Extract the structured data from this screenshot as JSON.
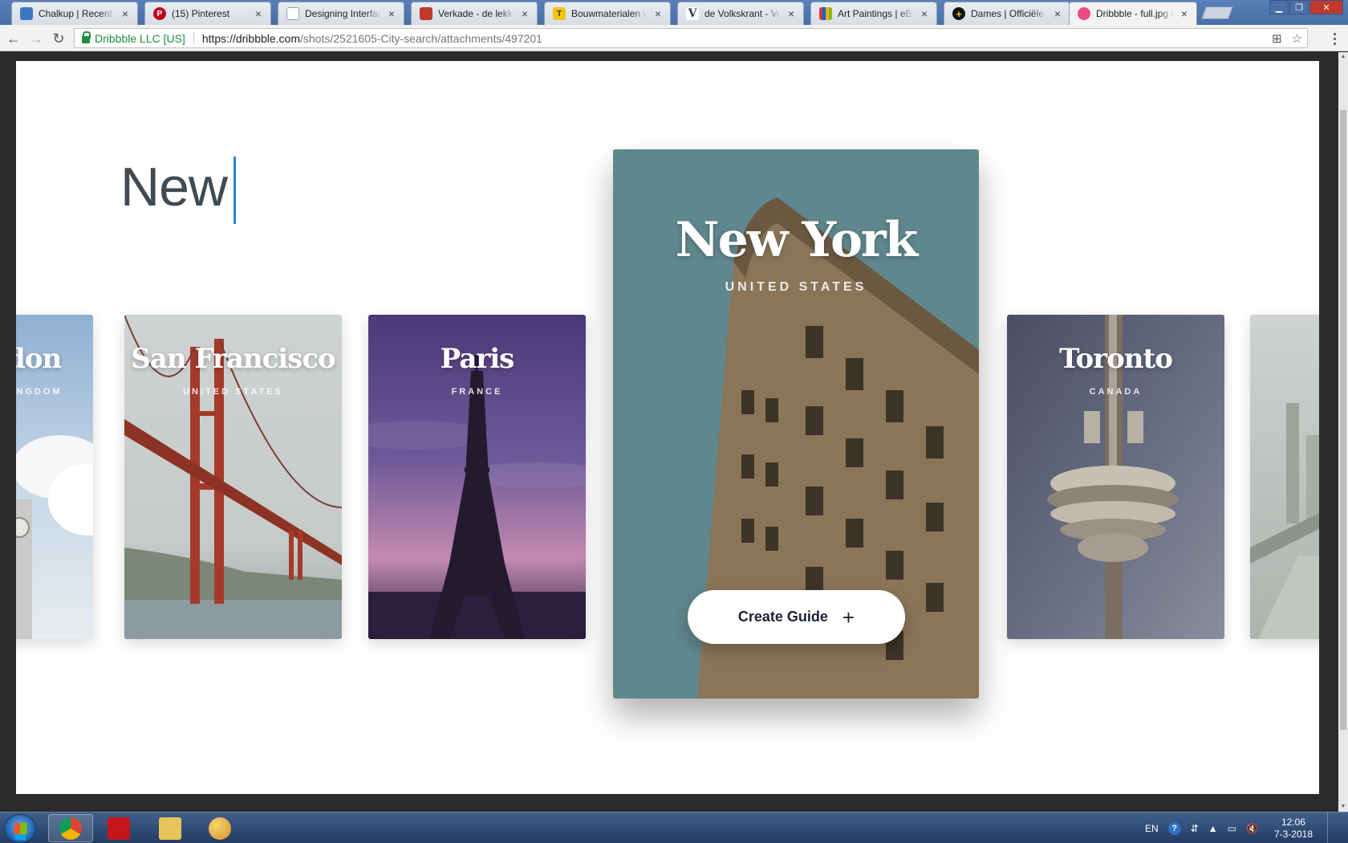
{
  "browser": {
    "tabs": [
      {
        "title": "Chalkup | Recent Ac",
        "favicon_color": "#3b78c4"
      },
      {
        "title": "(15) Pinterest",
        "favicon_color": "#bd081c"
      },
      {
        "title": "Designing Interfaces",
        "favicon_color": "#9aa3ad"
      },
      {
        "title": "Verkade - de lekker",
        "favicon_color": "#c0392b"
      },
      {
        "title": "Bouwmaterialen vo",
        "favicon_color": "#f1c40f"
      },
      {
        "title": "de Volkskrant - Voo",
        "favicon_color": "#2c3e50"
      },
      {
        "title": "Art Paintings | eBay",
        "favicon_color": "#6a1b9a"
      },
      {
        "title": "Dames | Officiële w",
        "favicon_color": "#111111"
      },
      {
        "title": "Dribbble - full.jpg b",
        "favicon_color": "#ea4c89"
      }
    ],
    "tab_close_glyph": "×",
    "nav": {
      "back": "←",
      "forward": "→",
      "reload": "↻"
    },
    "address": {
      "secure_label": "Dribbble LLC [US]",
      "url_host": "https://dribbble.com",
      "url_path": "/shots/2521605-City-search/attachments/497201"
    },
    "omni_icons": {
      "translate": "⊞",
      "star": "☆"
    },
    "window_controls": {
      "minimize": "▁",
      "maximize": "❐",
      "close": "✕"
    }
  },
  "page": {
    "search_query": "New",
    "cards": {
      "london": {
        "name": "London",
        "country": "UNITED KINGDOM"
      },
      "sf": {
        "name": "San Francisco",
        "country": "UNITED STATES"
      },
      "paris": {
        "name": "Paris",
        "country": "FRANCE"
      },
      "ny": {
        "name": "New York",
        "country": "UNITED STATES",
        "button_label": "Create Guide",
        "button_icon": "+"
      },
      "toronto": {
        "name": "Toronto",
        "country": "CANADA"
      }
    }
  },
  "taskbar": {
    "lang": "EN",
    "help": "?",
    "tray_icons": [
      "⇵",
      "▲",
      "▭",
      "🔇"
    ],
    "time": "12:06",
    "date": "7-3-2018"
  },
  "colors": {
    "caret": "#2f7ed8",
    "ny_card": "#5a7f86",
    "sf_card": "#c9cccc",
    "paris_card": "#5e4a86",
    "toronto_card": "#5a5f73"
  }
}
